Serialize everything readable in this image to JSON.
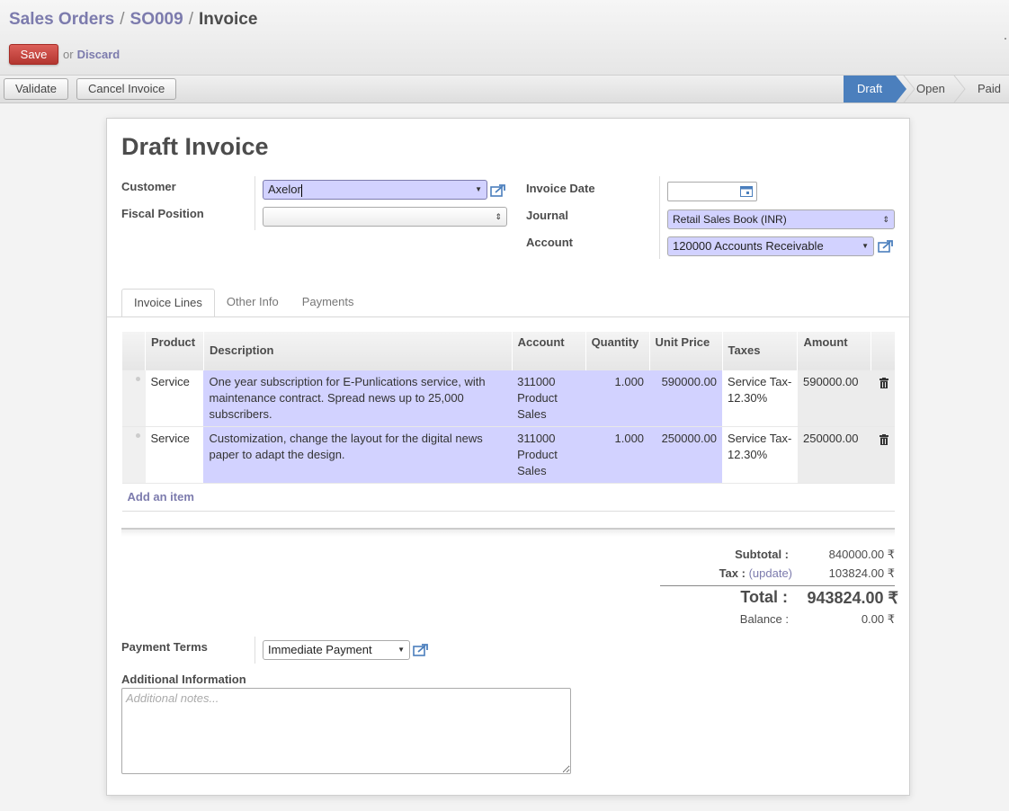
{
  "breadcrumb": {
    "item1": "Sales Orders",
    "item2": "SO009",
    "current": "Invoice",
    "sep": "/"
  },
  "actions": {
    "save": "Save",
    "or": "or",
    "discard": "Discard"
  },
  "statusbar": {
    "validate": "Validate",
    "cancel_invoice": "Cancel Invoice",
    "stages": [
      "Draft",
      "Open",
      "Paid"
    ],
    "active_stage": "Draft"
  },
  "colors": {
    "accent": "#7c7bad",
    "required_bg": "#d2d2ff",
    "save_red": "#c43c36",
    "stage_blue": "#4b7fbd"
  },
  "form": {
    "title": "Draft Invoice",
    "customer_label": "Customer",
    "customer_value": "Axelor",
    "fiscal_position_label": "Fiscal Position",
    "fiscal_position_value": "",
    "invoice_date_label": "Invoice Date",
    "invoice_date_value": "",
    "journal_label": "Journal",
    "journal_value": "Retail Sales Book (INR)",
    "account_label": "Account",
    "account_value": "120000 Accounts Receivable"
  },
  "tabs": [
    "Invoice Lines",
    "Other Info",
    "Payments"
  ],
  "lines": {
    "columns": [
      "Product",
      "Description",
      "Account",
      "Quantity",
      "Unit Price",
      "Taxes",
      "Amount"
    ],
    "rows": [
      {
        "product": "Service",
        "description": "One year subscription for E-Punlications service, with maintenance contract. Spread news up to 25,000 subscribers.",
        "account": "311000 Product Sales",
        "quantity": "1.000",
        "unit_price": "590000.00",
        "taxes": "Service Tax-12.30%",
        "amount": "590000.00"
      },
      {
        "product": "Service",
        "description": "Customization, change the layout for the digital news paper to adapt the design.",
        "account": "311000 Product Sales",
        "quantity": "1.000",
        "unit_price": "250000.00",
        "taxes": "Service Tax-12.30%",
        "amount": "250000.00"
      }
    ],
    "add_item": "Add an item"
  },
  "totals": {
    "subtotal_label": "Subtotal :",
    "subtotal_value": "840000.00 ₹",
    "tax_label": "Tax :",
    "tax_update": "(update)",
    "tax_value": "103824.00 ₹",
    "total_label": "Total :",
    "total_value": "943824.00 ₹",
    "balance_label": "Balance :",
    "balance_value": "0.00 ₹"
  },
  "payment_terms": {
    "label": "Payment Terms",
    "value": "Immediate Payment"
  },
  "additional_info": {
    "label": "Additional Information",
    "placeholder": "Additional notes..."
  }
}
